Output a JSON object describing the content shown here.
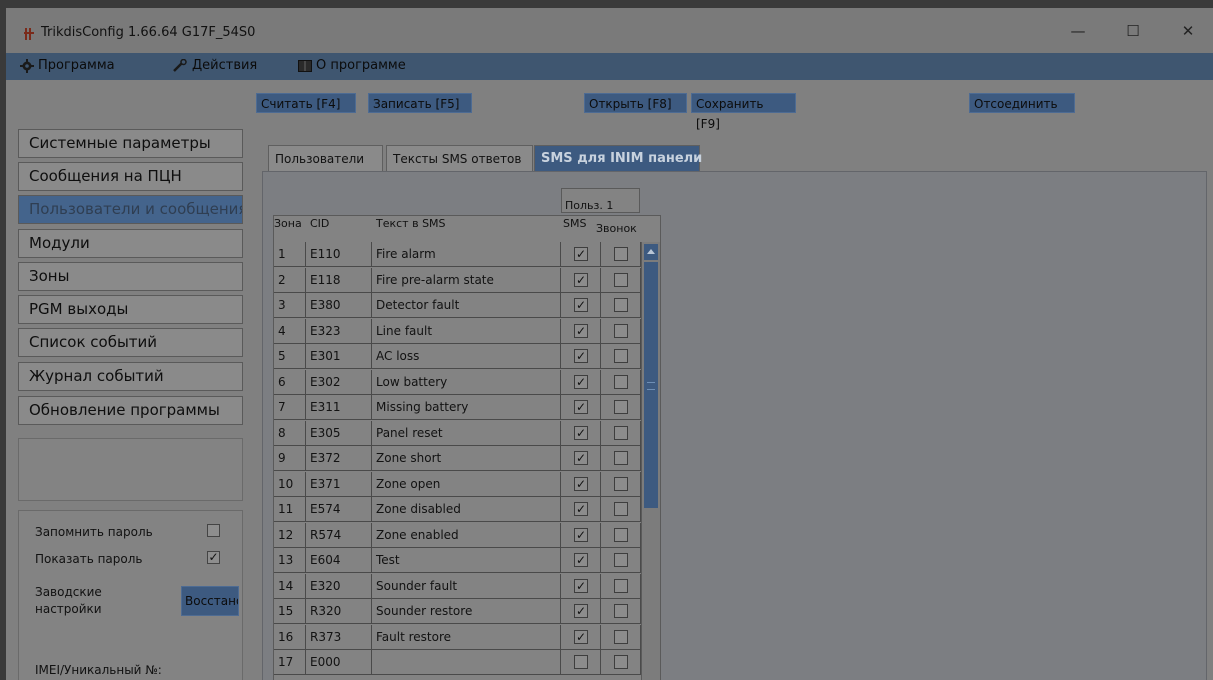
{
  "window": {
    "title": "TrikdisConfig 1.66.64   G17F_54S0",
    "controls": [
      "—",
      "☐",
      "✕"
    ]
  },
  "menu": [
    {
      "label": "Программа",
      "icon": "gear-icon"
    },
    {
      "label": "Действия",
      "icon": "wrench-icon"
    },
    {
      "label": "О программе",
      "icon": "book-icon"
    }
  ],
  "toolbar": {
    "read": "Считать [F4]",
    "write": "Записать [F5]",
    "open": "Открыть [F8]",
    "save": "Сохранить [F9]",
    "disconnect": "Отсоединить"
  },
  "nav": [
    "Системные параметры",
    "Сообщения на ПЦН",
    "Пользователи и сообщения",
    "Модули",
    "Зоны",
    "PGM выходы",
    "Список событий",
    "Журнал событий",
    "Обновление программы"
  ],
  "bottom_panel": {
    "remember_password": "Запомнить пароль",
    "remember_checked": false,
    "show_password": "Показать пароль",
    "show_checked": true,
    "factory_line1": "Заводские",
    "factory_line2": "настройки",
    "restore_button": "Восстановить",
    "imei_label": "IMEI/Уникальный №:"
  },
  "tabs": [
    {
      "label": "Пользователи",
      "active": false
    },
    {
      "label": "Тексты SMS ответов",
      "active": false
    },
    {
      "label": "SMS для INIM панели",
      "active": true
    }
  ],
  "table": {
    "group_header": "Польз. 1",
    "headers": {
      "zone": "Зона",
      "cid": "CID",
      "text": "Текст в SMS",
      "sms": "SMS",
      "call": "Звонок"
    },
    "rows": [
      {
        "zone": "1",
        "cid": "E110",
        "text": "Fire alarm",
        "sms": true,
        "call": false
      },
      {
        "zone": "2",
        "cid": "E118",
        "text": "Fire pre-alarm state",
        "sms": true,
        "call": false
      },
      {
        "zone": "3",
        "cid": "E380",
        "text": "Detector fault",
        "sms": true,
        "call": false
      },
      {
        "zone": "4",
        "cid": "E323",
        "text": "Line fault",
        "sms": true,
        "call": false
      },
      {
        "zone": "5",
        "cid": "E301",
        "text": "AC loss",
        "sms": true,
        "call": false
      },
      {
        "zone": "6",
        "cid": "E302",
        "text": "Low battery",
        "sms": true,
        "call": false
      },
      {
        "zone": "7",
        "cid": "E311",
        "text": "Missing battery",
        "sms": true,
        "call": false
      },
      {
        "zone": "8",
        "cid": "E305",
        "text": "Panel reset",
        "sms": true,
        "call": false
      },
      {
        "zone": "9",
        "cid": "E372",
        "text": "Zone short",
        "sms": true,
        "call": false
      },
      {
        "zone": "10",
        "cid": "E371",
        "text": "Zone open",
        "sms": true,
        "call": false
      },
      {
        "zone": "11",
        "cid": "E574",
        "text": "Zone disabled",
        "sms": true,
        "call": false
      },
      {
        "zone": "12",
        "cid": "R574",
        "text": "Zone enabled",
        "sms": true,
        "call": false
      },
      {
        "zone": "13",
        "cid": "E604",
        "text": "Test",
        "sms": true,
        "call": false
      },
      {
        "zone": "14",
        "cid": "E320",
        "text": "Sounder fault",
        "sms": true,
        "call": false
      },
      {
        "zone": "15",
        "cid": "R320",
        "text": "Sounder restore",
        "sms": true,
        "call": false
      },
      {
        "zone": "16",
        "cid": "R373",
        "text": "Fault restore",
        "sms": true,
        "call": false
      },
      {
        "zone": "17",
        "cid": "E000",
        "text": "",
        "sms": false,
        "call": false
      }
    ]
  },
  "colors": {
    "accent": "#3d5a80",
    "background": "#808080"
  }
}
